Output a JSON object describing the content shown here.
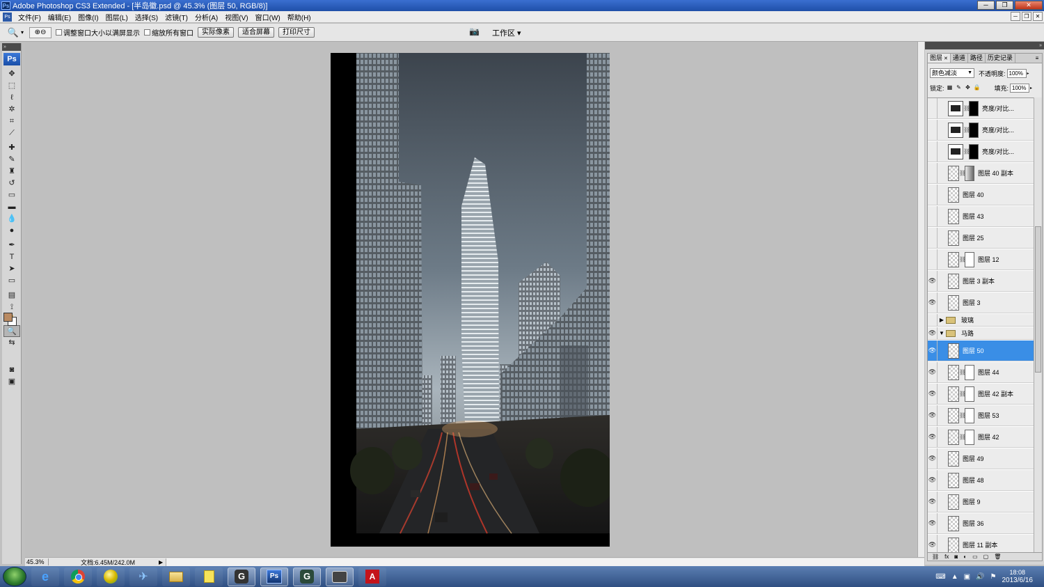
{
  "window": {
    "title": "Adobe Photoshop CS3 Extended - [半岛徽.psd @ 45.3% (图层 50, RGB/8)]",
    "app_icon": "Ps"
  },
  "menu": [
    "文件(F)",
    "编辑(E)",
    "图像(I)",
    "图层(L)",
    "选择(S)",
    "滤镜(T)",
    "分析(A)",
    "视图(V)",
    "窗口(W)",
    "帮助(H)"
  ],
  "options": {
    "checkbox_resize": "调整窗口大小以满屏显示",
    "checkbox_zoom_all": "缩放所有窗口",
    "btn_actual_pixels": "实际像素",
    "btn_fit_screen": "适合屏幕",
    "btn_print_size": "打印尺寸",
    "workspace": "工作区"
  },
  "toolbox": {
    "logo": "Ps",
    "foreground_color": "#b98a62",
    "background_color": "#ffffff"
  },
  "status": {
    "zoom": "45.3%",
    "doc_size": "文档:6.45M/242.0M"
  },
  "layers_panel": {
    "tabs": [
      "图层",
      "通道",
      "路径",
      "历史记录"
    ],
    "blend_mode": "颜色减淡",
    "opacity_label": "不透明度:",
    "opacity": "100%",
    "lock_label": "锁定:",
    "fill_label": "填充:",
    "fill": "100%",
    "layers": [
      {
        "name": "亮度/对比...",
        "visible": false,
        "type": "adjustment",
        "mask": "black"
      },
      {
        "name": "亮度/对比...",
        "visible": false,
        "type": "adjustment",
        "mask": "black"
      },
      {
        "name": "亮度/对比...",
        "visible": false,
        "type": "adjustment",
        "mask": "black"
      },
      {
        "name": "图层 40 副本",
        "visible": false,
        "type": "pixel",
        "mask": "grad"
      },
      {
        "name": "图层 40",
        "visible": false,
        "type": "pixel"
      },
      {
        "name": "图层 43",
        "visible": false,
        "type": "pixel"
      },
      {
        "name": "图层 25",
        "visible": false,
        "type": "pixel"
      },
      {
        "name": "图层 12",
        "visible": false,
        "type": "pixel",
        "mask": "white"
      },
      {
        "name": "图层 3 副本",
        "visible": true,
        "type": "pixel"
      },
      {
        "name": "图层 3",
        "visible": true,
        "type": "pixel"
      },
      {
        "name": "玻璃",
        "visible": false,
        "type": "group",
        "expanded": false
      },
      {
        "name": "马路",
        "visible": true,
        "type": "group",
        "expanded": true
      },
      {
        "name": "图层 50",
        "visible": true,
        "type": "pixel",
        "selected": true
      },
      {
        "name": "图层 44",
        "visible": true,
        "type": "pixel",
        "mask": "white"
      },
      {
        "name": "图层 42 副本",
        "visible": true,
        "type": "pixel",
        "mask": "white"
      },
      {
        "name": "图层 53",
        "visible": true,
        "type": "pixel",
        "mask": "white"
      },
      {
        "name": "图层 42",
        "visible": true,
        "type": "pixel",
        "mask": "white"
      },
      {
        "name": "图层 49",
        "visible": true,
        "type": "pixel"
      },
      {
        "name": "图层 48",
        "visible": true,
        "type": "pixel"
      },
      {
        "name": "图层 9",
        "visible": true,
        "type": "pixel"
      },
      {
        "name": "图层 36",
        "visible": true,
        "type": "pixel"
      },
      {
        "name": "图层 11 副本",
        "visible": true,
        "type": "pixel"
      }
    ]
  },
  "taskbar": {
    "clock_date": "2013/6/16",
    "clock_time": "18:08"
  }
}
